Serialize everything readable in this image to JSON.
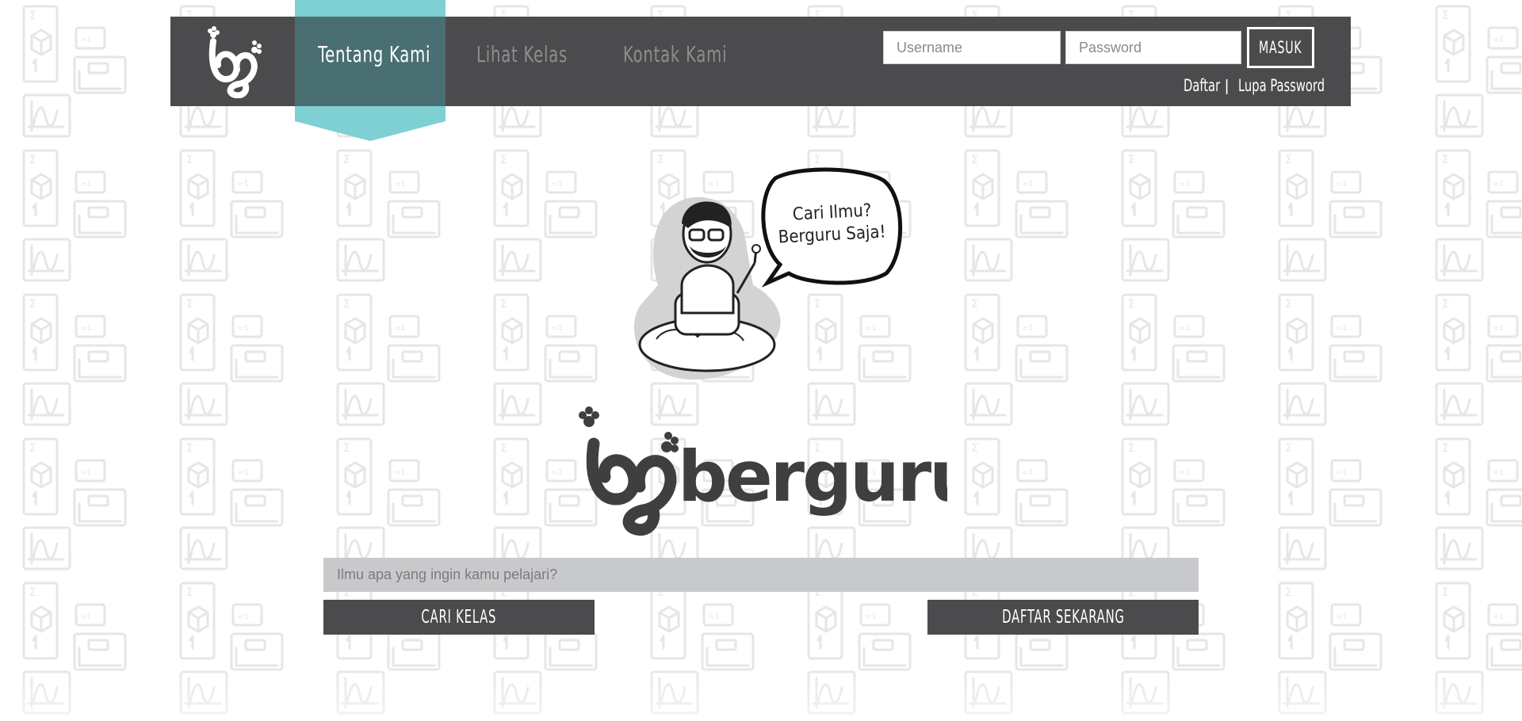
{
  "nav": {
    "items": [
      {
        "label": "Tentang Kami",
        "active": true
      },
      {
        "label": "Lihat Kelas",
        "active": false
      },
      {
        "label": "Kontak Kami",
        "active": false
      }
    ],
    "active_color": "#7fd0d2",
    "bar_color": "#4b4b4d"
  },
  "login": {
    "username_placeholder": "Username",
    "password_placeholder": "Password",
    "submit_label": "MASUK",
    "register_link": "Daftar",
    "separator": "|",
    "forgot_link": "Lupa Password"
  },
  "hero": {
    "speech_line1": "Cari Ilmu?",
    "speech_line2": "Berguru Saja!",
    "brand_name": "berguru"
  },
  "search": {
    "placeholder": "Ilmu apa yang ingin kamu pelajari?",
    "value": ""
  },
  "actions": {
    "search_label": "CARI KELAS",
    "register_label": "DAFTAR SEKARANG"
  },
  "icons": [
    "logo-mark-icon",
    "mascot-icon",
    "speech-bubble-icon"
  ]
}
